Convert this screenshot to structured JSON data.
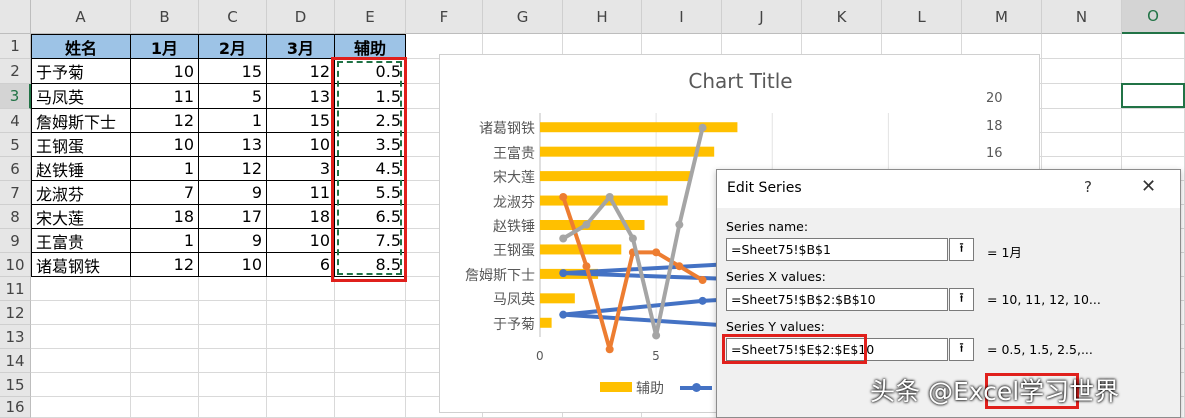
{
  "columns": [
    "A",
    "B",
    "C",
    "D",
    "E",
    "F",
    "G",
    "H",
    "I",
    "J",
    "K",
    "L",
    "M",
    "N",
    "O"
  ],
  "rows": [
    "1",
    "2",
    "3",
    "4",
    "5",
    "6",
    "7",
    "8",
    "9",
    "10",
    "11",
    "12",
    "13",
    "14",
    "15",
    "16"
  ],
  "table": {
    "headers": [
      "姓名",
      "1月",
      "2月",
      "3月",
      "辅助"
    ],
    "rows": [
      [
        "于予菊",
        "10",
        "15",
        "12",
        "0.5"
      ],
      [
        "马凤英",
        "11",
        "5",
        "13",
        "1.5"
      ],
      [
        "詹姆斯下士",
        "12",
        "1",
        "15",
        "2.5"
      ],
      [
        "王钢蛋",
        "10",
        "13",
        "10",
        "3.5"
      ],
      [
        "赵铁锤",
        "1",
        "12",
        "3",
        "4.5"
      ],
      [
        "龙淑芬",
        "7",
        "9",
        "11",
        "5.5"
      ],
      [
        "宋大莲",
        "18",
        "17",
        "18",
        "6.5"
      ],
      [
        "王富贵",
        "1",
        "9",
        "10",
        "7.5"
      ],
      [
        "诸葛钢铁",
        "12",
        "10",
        "6",
        "8.5"
      ]
    ]
  },
  "chart_data": {
    "type": "bar",
    "title": "Chart Title",
    "categories": [
      "于予菊",
      "马凤英",
      "詹姆斯下士",
      "王钢蛋",
      "赵铁锤",
      "龙淑芬",
      "宋大莲",
      "王富贵",
      "诸葛钢铁"
    ],
    "series": [
      {
        "name": "辅助",
        "type": "bar",
        "values": [
          0.5,
          1.5,
          2.5,
          3.5,
          4.5,
          5.5,
          6.5,
          7.5,
          8.5
        ],
        "color": "#ffc000"
      },
      {
        "type": "line",
        "x": [
          10,
          11,
          12,
          10,
          1,
          7,
          18,
          1,
          12
        ],
        "y": [
          0.5,
          1.5,
          2.5,
          3.5,
          4.5,
          5.5,
          6.5,
          7.5,
          8.5
        ],
        "color": "#4472c4"
      },
      {
        "type": "line",
        "x": [
          1,
          2,
          3,
          4,
          5,
          6,
          7
        ],
        "y": [
          13,
          8,
          2,
          9,
          9,
          8,
          7
        ],
        "color": "#ed7d31"
      },
      {
        "type": "line",
        "x": [
          1,
          2,
          3,
          4,
          5,
          6,
          7
        ],
        "y": [
          10,
          11,
          13,
          10,
          3,
          11,
          18
        ],
        "color": "#a5a5a5"
      }
    ],
    "x_ticks": [
      "0",
      "5"
    ],
    "y2_ticks": [
      "20",
      "18",
      "16"
    ],
    "xlim": [
      0,
      15.5
    ],
    "y2lim": [
      0,
      20
    ],
    "legend": {
      "position": "bottom",
      "visible_label": "辅助"
    }
  },
  "dialog": {
    "title": "Edit Series",
    "help": "?",
    "close": "✕",
    "series_name_label": "Series name:",
    "series_name_value": "=Sheet75!$B$1",
    "series_name_result": "= 1月",
    "x_label": "Series X values:",
    "x_value": "=Sheet75!$B$2:$B$10",
    "x_result": "= 10, 11, 12, 10...",
    "y_label": "Series Y values:",
    "y_value": "=Sheet75!$E$2:$E$10",
    "y_result": "= 0.5, 1.5, 2.5,...",
    "collapse_icon": "⭱"
  },
  "watermark": "头条 @Excel学习世界",
  "colors": {
    "header_fill": "#9dc3e6",
    "highlight": "#e0201c",
    "excel_green": "#217346"
  }
}
